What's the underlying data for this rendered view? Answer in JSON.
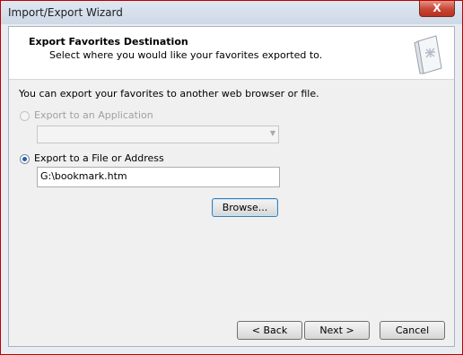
{
  "window": {
    "title": "Import/Export Wizard",
    "close_label": "X"
  },
  "header": {
    "title": "Export Favorites Destination",
    "subtitle": "Select where you would like your favorites exported to."
  },
  "body": {
    "intro": "You can export your favorites to another web browser or file.",
    "option_app": {
      "label": "Export to an Application",
      "selected": false,
      "enabled": false
    },
    "app_combo": {
      "value": ""
    },
    "option_file": {
      "label": "Export to a File or Address",
      "selected": true,
      "enabled": true
    },
    "file_path": {
      "value": "G:\\bookmark.htm"
    },
    "browse_label": "Browse..."
  },
  "footer": {
    "back_label": "< Back",
    "next_label": "Next >",
    "cancel_label": "Cancel"
  },
  "icons": {
    "close": "close-icon",
    "header": "favorites-book-icon",
    "combo": "chevron-down-icon"
  }
}
